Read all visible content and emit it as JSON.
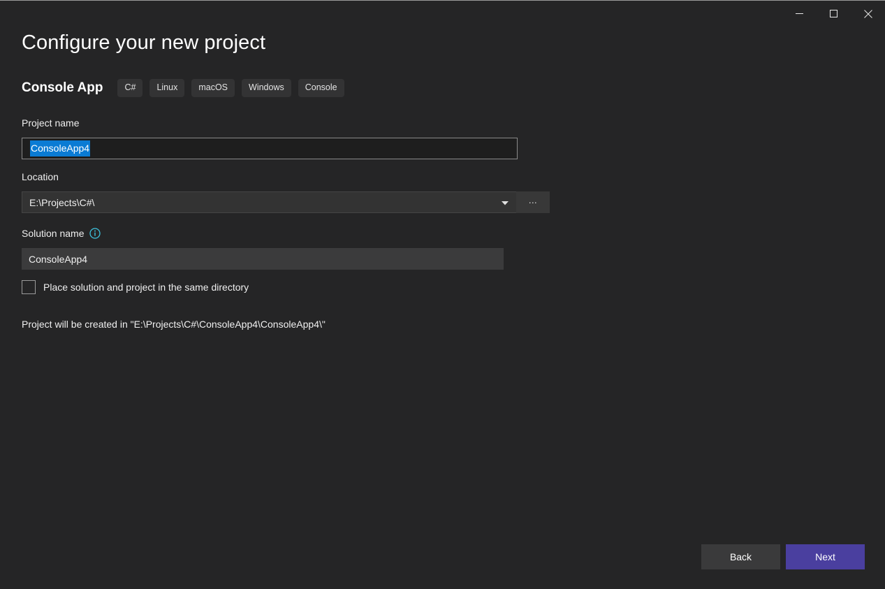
{
  "window": {
    "controls": [
      {
        "name": "minimize",
        "glyph": "minimize-icon",
        "label": "Minimize"
      },
      {
        "name": "maximize",
        "glyph": "maximize-icon",
        "label": "Maximize"
      },
      {
        "name": "close",
        "glyph": "close-icon",
        "label": "Close"
      }
    ]
  },
  "header": {
    "title": "Configure your new project",
    "template_name": "Console App",
    "tags": [
      "C#",
      "Linux",
      "macOS",
      "Windows",
      "Console"
    ]
  },
  "form": {
    "project_name": {
      "label": "Project name",
      "value": "ConsoleApp4",
      "selected": true
    },
    "location": {
      "label": "Location",
      "value": "E:\\Projects\\C#\\",
      "dropdown_icon": "chevron-down-icon",
      "browse_label": "..."
    },
    "solution_name": {
      "label": "Solution name",
      "info_icon": "info-icon",
      "value": "ConsoleApp4"
    },
    "same_directory": {
      "label": "Place solution and project in the same directory",
      "checked": false
    },
    "created_in": "Project will be created in \"E:\\Projects\\C#\\ConsoleApp4\\ConsoleApp4\\\""
  },
  "footer": {
    "back_label": "Back",
    "next_label": "Next"
  },
  "colors": {
    "background": "#252526",
    "accent_primary": "#4a3f9f",
    "selection_blue": "#0a7bd4",
    "info_cyan": "#3ec3de",
    "field_flat": "#3b3b3c",
    "field_dark": "#1e1e1e",
    "chip": "#333334"
  }
}
